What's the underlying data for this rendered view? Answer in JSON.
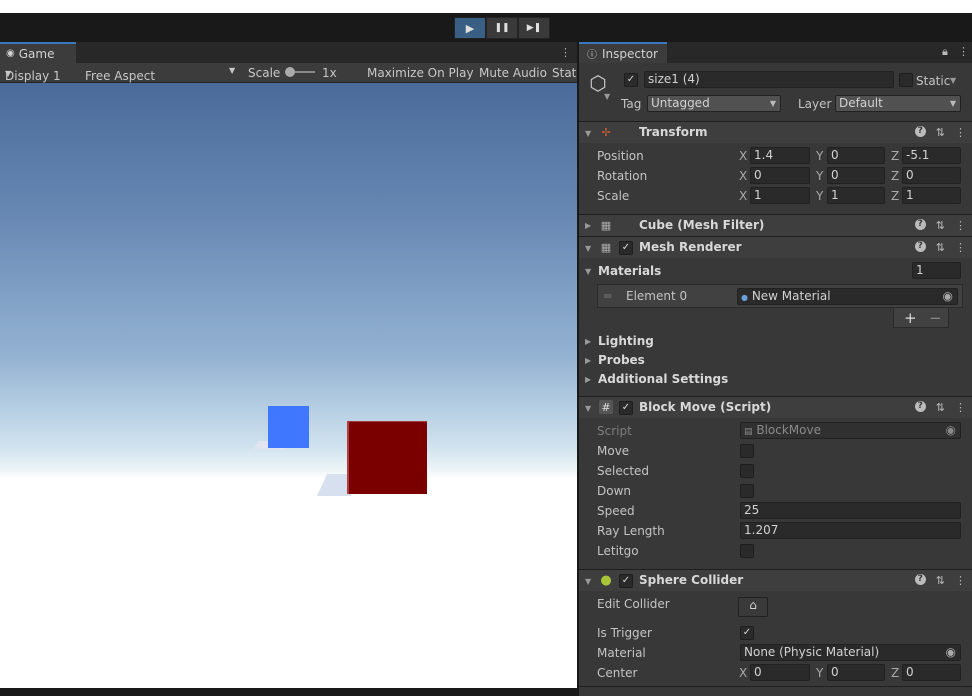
{
  "toolbar": {
    "play_glyph": "▶",
    "pause_glyph": "❚❚",
    "step_glyph": "▶❚"
  },
  "game": {
    "tab_label": "Game",
    "display": "Display 1",
    "aspect": "Free Aspect",
    "scale_label": "Scale",
    "scale_value": "1x",
    "maximize": "Maximize On Play",
    "mute": "Mute Audio",
    "stats": "Stat"
  },
  "inspector": {
    "tab_label": "Inspector",
    "object_name": "size1 (4)",
    "static_label": "Static",
    "tag_label": "Tag",
    "tag_value": "Untagged",
    "layer_label": "Layer",
    "layer_value": "Default",
    "transform": {
      "title": "Transform",
      "position": {
        "label": "Position",
        "x": "1.4",
        "y": "0",
        "z": "-5.1"
      },
      "rotation": {
        "label": "Rotation",
        "x": "0",
        "y": "0",
        "z": "0"
      },
      "scale": {
        "label": "Scale",
        "x": "1",
        "y": "1",
        "z": "1"
      },
      "axis_x": "X",
      "axis_y": "Y",
      "axis_z": "Z"
    },
    "mesh_filter": {
      "title": "Cube (Mesh Filter)"
    },
    "mesh_renderer": {
      "title": "Mesh Renderer",
      "materials_label": "Materials",
      "materials_count": "1",
      "element_label": "Element 0",
      "element_value": "New Material",
      "add": "+",
      "remove": "−",
      "lighting": "Lighting",
      "probes": "Probes",
      "additional": "Additional Settings"
    },
    "block_move": {
      "title": "Block Move (Script)",
      "script_label": "Script",
      "script_value": "BlockMove",
      "move": "Move",
      "selected": "Selected",
      "down": "Down",
      "speed_label": "Speed",
      "speed_value": "25",
      "ray_label": "Ray Length",
      "ray_value": "1.207",
      "letitgo": "Letitgo"
    },
    "sphere_collider": {
      "title": "Sphere Collider",
      "edit_label": "Edit Collider",
      "trigger_label": "Is Trigger",
      "material_label": "Material",
      "material_value": "None (Physic Material)",
      "center_label": "Center",
      "center_x": "0",
      "center_y": "0",
      "center_z": "0"
    }
  }
}
